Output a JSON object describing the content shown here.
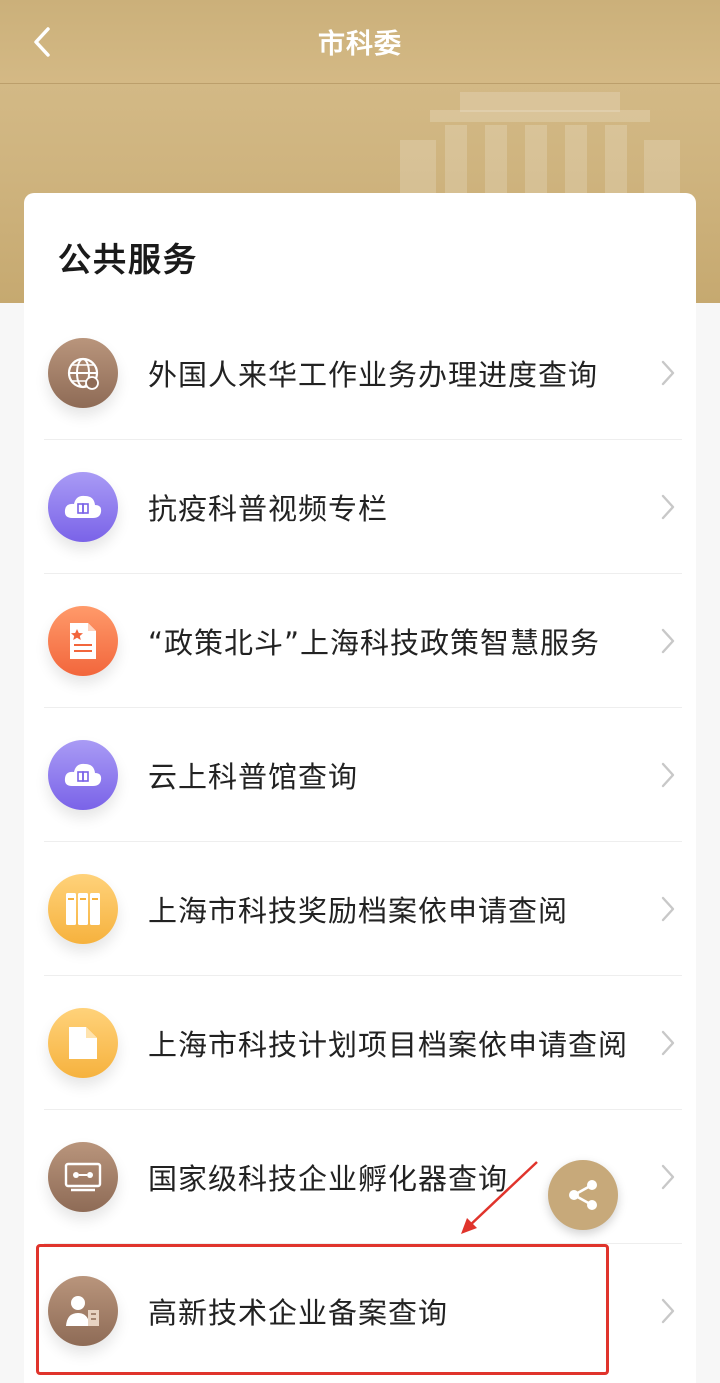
{
  "nav": {
    "title": "市科委"
  },
  "section": {
    "title": "公共服务"
  },
  "items": [
    {
      "label": "外国人来华工作业务办理进度查询",
      "icon": "globe-icon",
      "color_from": "#b9957c",
      "color_to": "#8e6b56"
    },
    {
      "label": "抗疫科普视频专栏",
      "icon": "cloud-book-icon",
      "color_from": "#a99bf5",
      "color_to": "#7a63e8"
    },
    {
      "label": "“政策北斗”上海科技政策智慧服务",
      "icon": "document-star-icon",
      "color_from": "#ff9a6a",
      "color_to": "#f2663c"
    },
    {
      "label": "云上科普馆查询",
      "icon": "cloud-book-icon",
      "color_from": "#a99bf5",
      "color_to": "#7a63e8"
    },
    {
      "label": "上海市科技奖励档案依申请查阅",
      "icon": "archive-binders-icon",
      "color_from": "#ffd27a",
      "color_to": "#f6b23e"
    },
    {
      "label": "上海市科技计划项目档案依申请查阅",
      "icon": "folder-icon",
      "color_from": "#ffd27a",
      "color_to": "#f6b23e"
    },
    {
      "label": "国家级科技企业孵化器查询",
      "icon": "incubator-screen-icon",
      "color_from": "#b9957c",
      "color_to": "#8e6b56"
    },
    {
      "label": "高新技术企业备案查询",
      "icon": "enterprise-person-icon",
      "color_from": "#b9957c",
      "color_to": "#8e6b56"
    }
  ],
  "colors": {
    "header_gold": "#cfb47f",
    "highlight_red": "#e0342c",
    "share_button": "#c7a97a"
  }
}
